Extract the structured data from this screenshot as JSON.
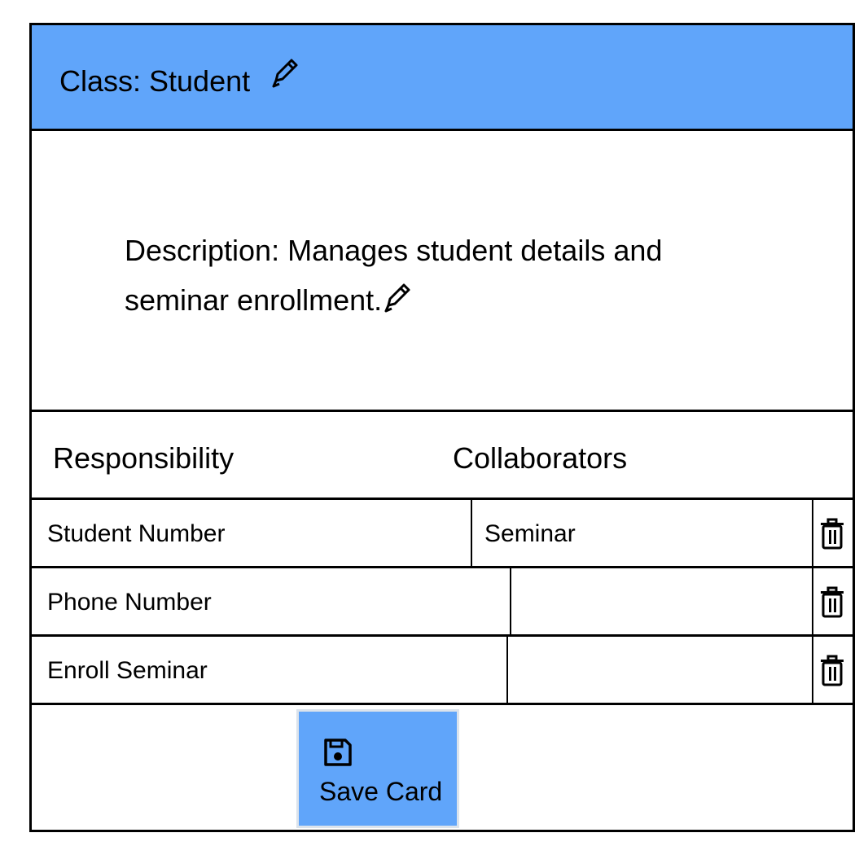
{
  "card": {
    "class_title": "Class: Student",
    "description": "Description: Manages student details and seminar enrollment.",
    "column_headers": {
      "responsibility": "Responsibility",
      "collaborators": "Collaborators"
    },
    "rows": [
      {
        "responsibility": "Student Number",
        "collaborator": "Seminar"
      },
      {
        "responsibility": "Phone Number",
        "collaborator": ""
      },
      {
        "responsibility": "Enroll Seminar",
        "collaborator": ""
      }
    ],
    "save_label": "Save Card"
  },
  "icons": {
    "edit": "pencil-icon",
    "delete": "trash-icon",
    "save": "floppy-disk-icon"
  },
  "colors": {
    "header_bg": "#60a5fa",
    "button_bg": "#60a5fa",
    "border": "#000000"
  }
}
